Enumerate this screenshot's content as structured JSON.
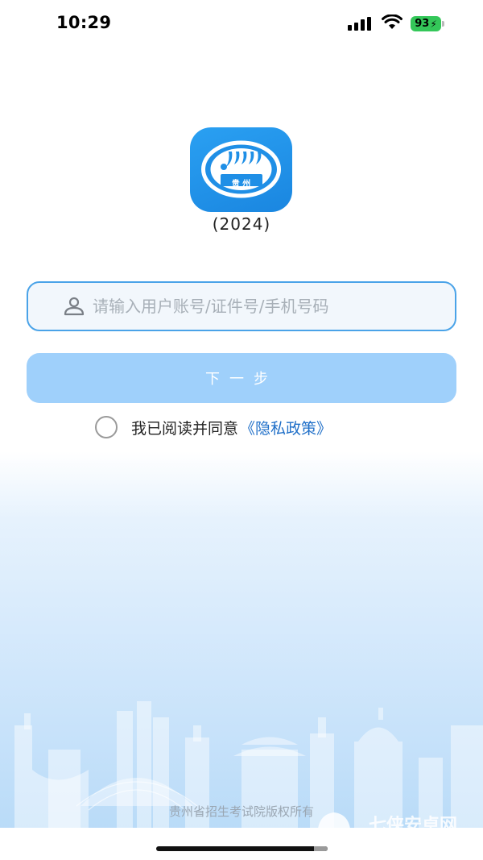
{
  "status_bar": {
    "time": "10:29",
    "battery": "93"
  },
  "app": {
    "logo_text": "贵 州",
    "version": "(2024)"
  },
  "login": {
    "account_placeholder": "请输入用户账号/证件号/手机号码",
    "account_value": "",
    "next_button": "下一步",
    "agree_text": "我已阅读并同意",
    "privacy_link": "《隐私政策》",
    "agree_checked": false
  },
  "footer": {
    "copyright": "贵州省招生考试院版权所有",
    "watermark": "七侠安卓网"
  },
  "colors": {
    "accent": "#1f6fc8",
    "button_disabled": "#9fd0fb",
    "input_border": "#4aa3e8",
    "logo_bg": "#1a86e0"
  },
  "icons": [
    "signal-icon",
    "wifi-icon",
    "battery-icon",
    "user-icon",
    "skyline-illustration"
  ]
}
